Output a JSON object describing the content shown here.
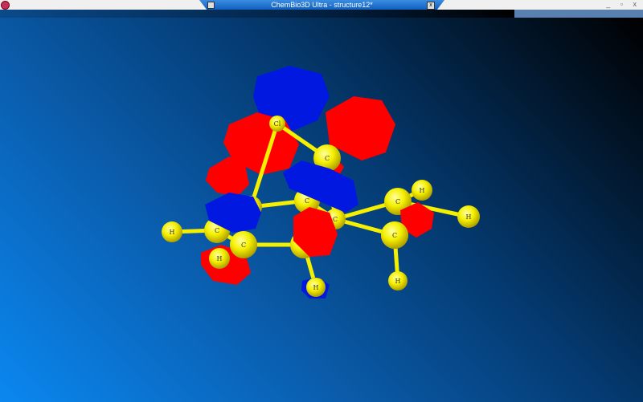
{
  "window": {
    "title": "ChemBio3D Ultra - structure12*",
    "close_label": "x",
    "controls": "_ ▫ x"
  },
  "colors": {
    "atom": "#f5f000",
    "positive_lobe": "#ff0000",
    "negative_lobe": "#0018e0",
    "bond": "#f5f000"
  },
  "atoms": [
    {
      "label": "Cl"
    },
    {
      "label": "C"
    },
    {
      "label": "C"
    },
    {
      "label": "C"
    },
    {
      "label": "C"
    },
    {
      "label": "H"
    },
    {
      "label": "H"
    },
    {
      "label": "C"
    },
    {
      "label": "H"
    },
    {
      "label": "C"
    },
    {
      "label": "H"
    },
    {
      "label": "C"
    },
    {
      "label": "H"
    },
    {
      "label": "C"
    },
    {
      "label": "H"
    },
    {
      "label": ""
    }
  ]
}
